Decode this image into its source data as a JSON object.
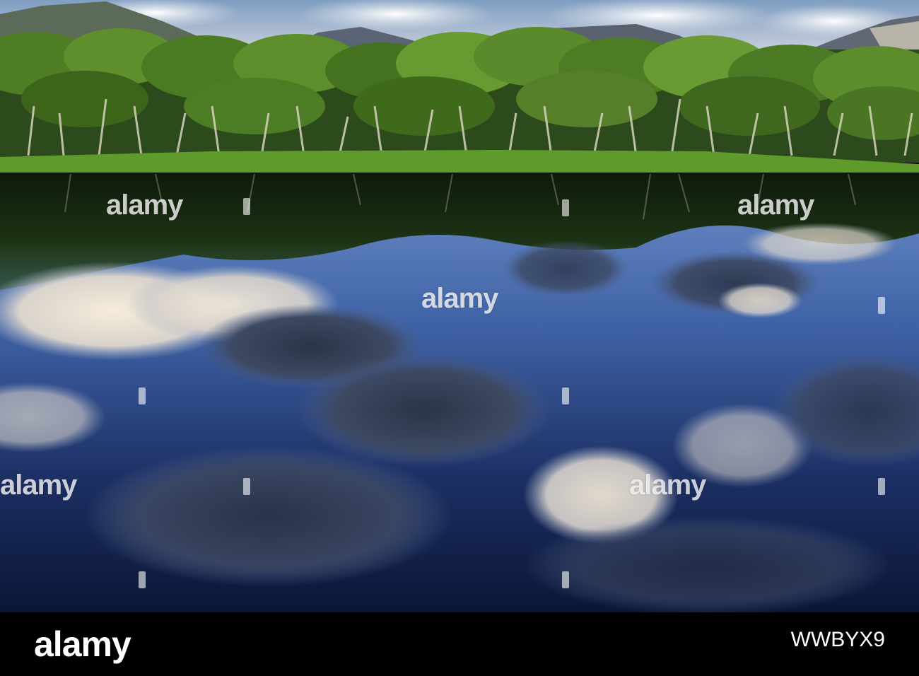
{
  "watermark": {
    "text": "alamy"
  },
  "footer": {
    "logo": "alamy",
    "image_id": "WWBYX9"
  },
  "colors": {
    "sky_top": "#7f9ec2",
    "sky_light": "#d9dde6",
    "mountain": "#59626e",
    "foliage_dark": "#2f4d1e",
    "foliage_light": "#6f9c2e",
    "grass": "#5f9a2c",
    "water_top": "#6f8fc4",
    "water_deep": "#0d1a3d",
    "cloud_light": "#f2e9d8",
    "cloud_dark": "#4a5570"
  }
}
